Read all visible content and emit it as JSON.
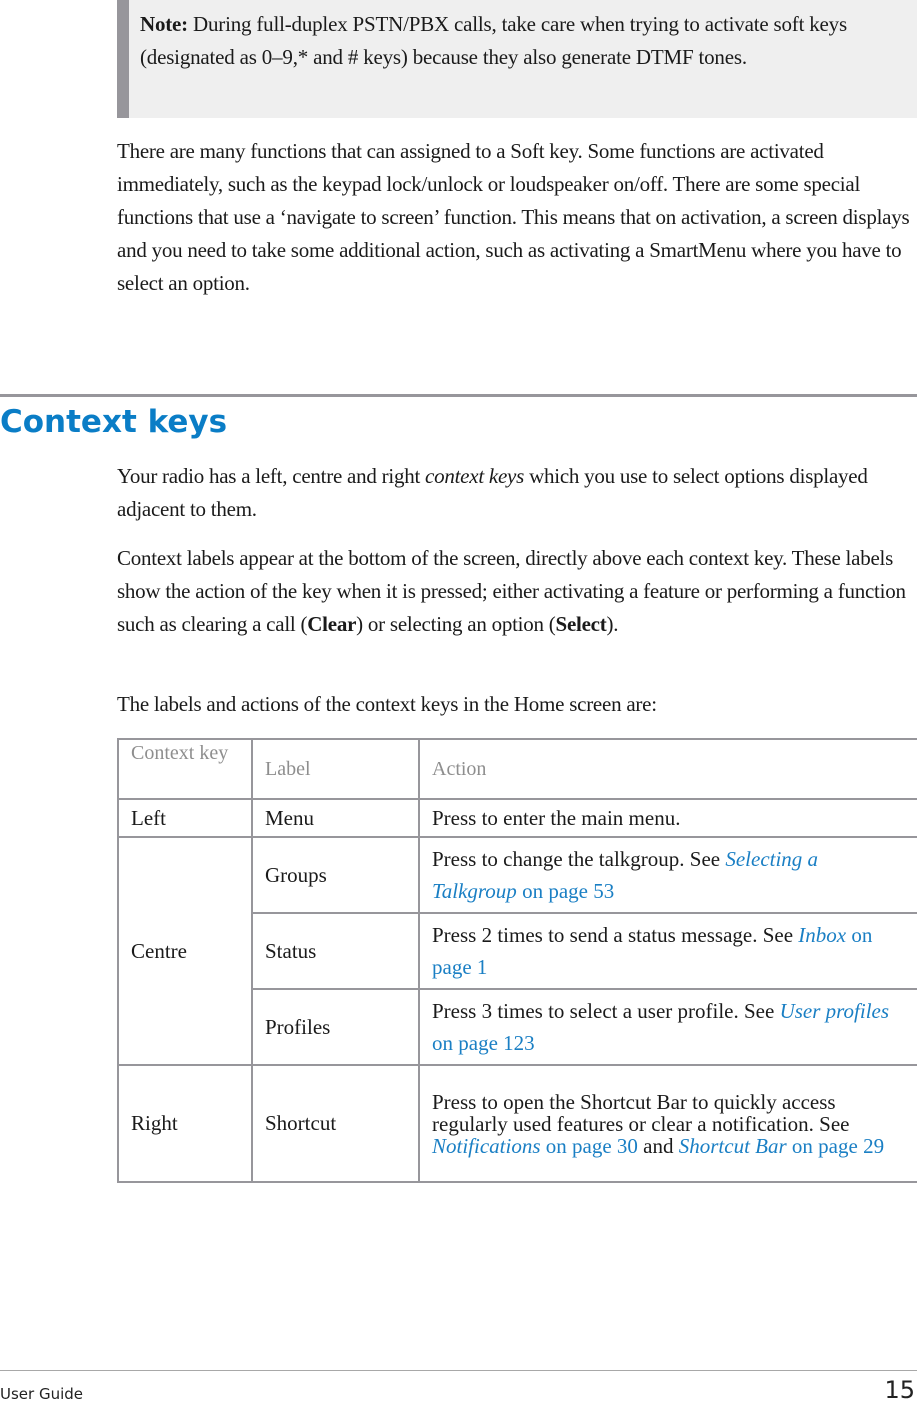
{
  "note": {
    "label": "Note:",
    "text": " During full-duplex PSTN/PBX calls, take care when trying to activate soft keys (designated as 0–9,* and # keys) because they also generate DTMF tones."
  },
  "intro_paragraph": "There are many functions that can assigned to a Soft key. Some functions are activated immediately, such as the keypad lock/unlock or loudspeaker on/off. There are some special functions that use a ‘navigate to screen’ function. This means that on activation, a screen displays and you need to take some additional action, such as activating a SmartMenu where you have to select an option.",
  "section": {
    "heading": "Context keys",
    "p1": {
      "before": "Your radio has a left, centre and right ",
      "emphasis": "context keys",
      "after": " which you use to select options displayed adjacent to them."
    },
    "p2": {
      "before": "Context labels appear at the bottom of the screen, directly above each context key. These labels show the action of the key when it is pressed; either activating a feature or performing a function such as clearing a call (",
      "bold1": "Clear",
      "middle": ") or selecting an option (",
      "bold2": "Select",
      "after": ")."
    },
    "p3": "The labels and actions of the context keys in the Home screen are:"
  },
  "table": {
    "headers": [
      "Context key",
      "Label",
      "Action"
    ],
    "rows": [
      {
        "key": "Left",
        "label": "Menu",
        "action": "Press to enter the main menu."
      },
      {
        "key": "Centre",
        "label": "Groups",
        "action": "Press to change the talkgroup. See ",
        "link": "Selecting a Talkgroup",
        "page": " on page 53"
      },
      {
        "key": "",
        "label": "Status",
        "action": "Press 2 times to send a status message. See ",
        "link": "Inbox",
        "page": " on page 1"
      },
      {
        "key": "",
        "label": "Profiles",
        "action": "Press 3 times to select a user profile. See ",
        "link": "User profiles",
        "page": "  on page 123"
      },
      {
        "key": "Right",
        "label": "Shortcut",
        "action": "Press to open the Shortcut Bar to quickly access regularly used features or clear a notification. See ",
        "link": "Notifications",
        "page": "  on page 30",
        "and": " and ",
        "link2": "Shortcut Bar",
        "page2": " on page 29"
      }
    ]
  },
  "footer": {
    "title": "User Guide",
    "page_number": "15"
  },
  "colors": {
    "heading": "#0a7dc6",
    "link": "#1a7fc4",
    "rule": "#97969b",
    "note_bg": "#efefef"
  }
}
